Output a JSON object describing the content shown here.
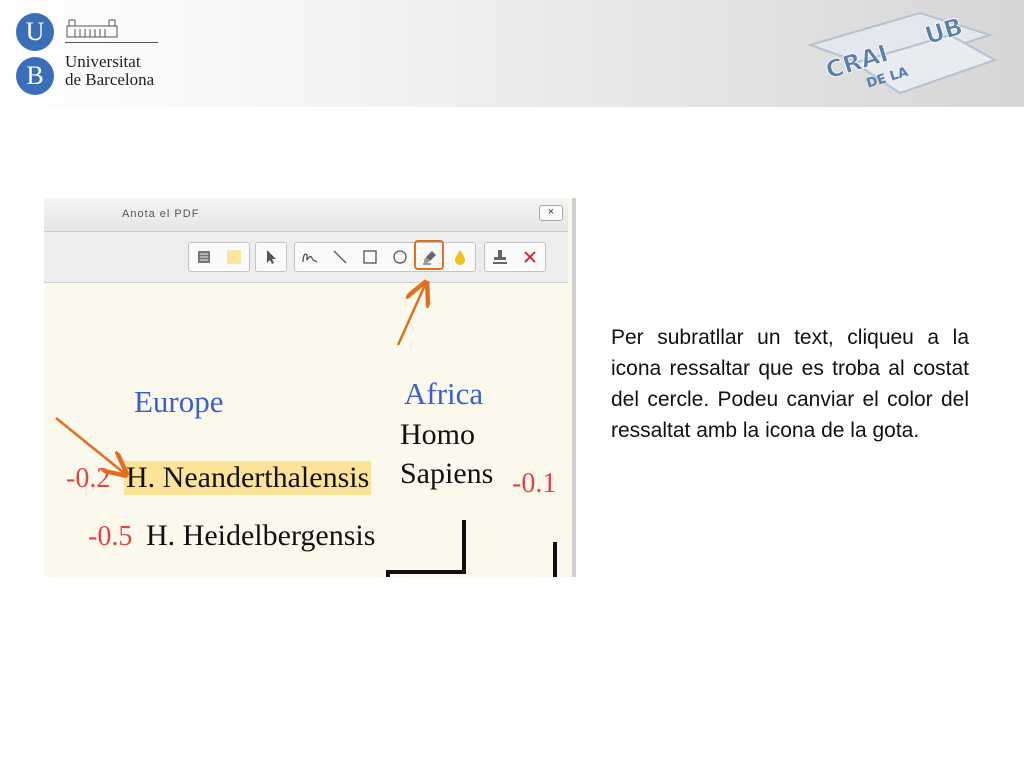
{
  "header": {
    "logo_letter_top": "U",
    "logo_letter_bottom": "B",
    "university_line1": "Universitat",
    "university_line2": "de Barcelona",
    "crai_logo": {
      "word1": "CRAI",
      "word2": "DE LA",
      "word3": "UB"
    }
  },
  "window": {
    "title": "Anota el PDF",
    "close_label": "×"
  },
  "toolbar": {
    "groups": [
      [
        "notes-icon",
        "sticky-note-icon"
      ],
      [
        "pointer-icon"
      ],
      [
        "freehand-icon",
        "line-icon",
        "rectangle-icon",
        "circle-icon",
        "highlighter-icon",
        "color-drop-icon"
      ],
      [
        "stamp-icon",
        "delete-icon"
      ]
    ],
    "selected_tool": "highlighter-icon",
    "colors": {
      "selected_outline": "#e07020",
      "drop": "#f2c21a",
      "delete": "#d03030"
    }
  },
  "document": {
    "europe": "Europe",
    "africa": "Africa",
    "homo": "Homo",
    "sapiens": "Sapiens",
    "row1_value": "-0.2",
    "row1_label": "H. Neanderthalensis",
    "row2_value": "-0.5",
    "row2_label": "H. Heidelbergensis",
    "right_value": "-0.1",
    "highlight_color": "#fbe39a"
  },
  "caption": "Per subratllar un text, cliqueu a la icona ressaltar que es troba al costat del cercle. Podeu canviar el color del ressaltat amb la icona de la  gota.",
  "annotation_color": "#e07020"
}
